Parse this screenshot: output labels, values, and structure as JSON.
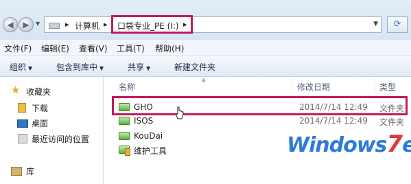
{
  "window": {
    "address": {
      "breadcrumb": [
        "计算机",
        "口袋专业_PE (I:)"
      ],
      "highlighted_crumb": "口袋专业_PE (I:)"
    }
  },
  "menu": [
    "文件(F)",
    "编辑(E)",
    "查看(V)",
    "工具(T)",
    "帮助(H)"
  ],
  "toolbar": {
    "organize": "组织",
    "include_library": "包含到库中",
    "share": "共享",
    "new_folder": "新建文件夹"
  },
  "nav": {
    "favorites": "收藏夹",
    "items": [
      "下载",
      "桌面",
      "最近访问的位置"
    ],
    "library": "库"
  },
  "columns": {
    "name": "名称",
    "date": "修改日期",
    "type": "类型"
  },
  "files": [
    {
      "name": "GHO",
      "date": "2014/7/14 12:49",
      "type": "文件夹"
    },
    {
      "name": "ISOS",
      "date": "2014/7/14 12:49",
      "type": "文件夹"
    },
    {
      "name": "KouDai",
      "date": "",
      "type": ""
    },
    {
      "name": "维护工具",
      "date": "",
      "type": ""
    }
  ],
  "watermark": {
    "part1": "Windows",
    "seven": "7",
    "part2": "en"
  },
  "colors": {
    "highlight": "#c2185b",
    "folder": "#5fae3f",
    "watermark_blue": "#2e7bd6",
    "watermark_red": "#e23a3a"
  }
}
